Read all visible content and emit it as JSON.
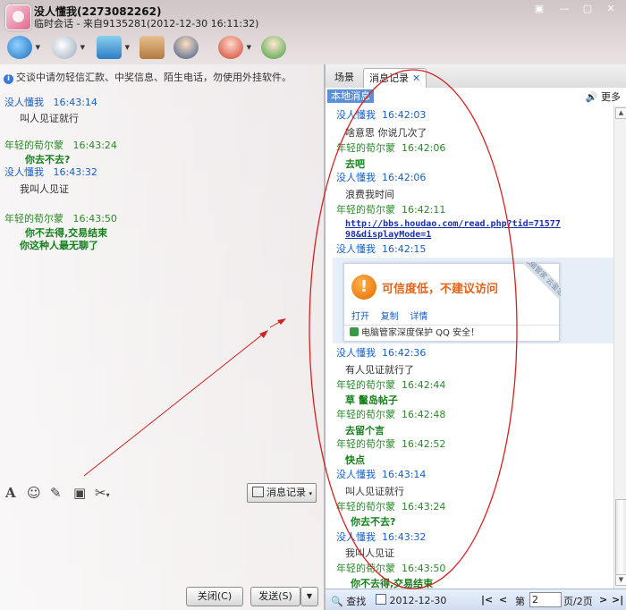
{
  "window": {
    "contact_name": "没人懂我(2273082262)",
    "session_info": "临时会话 - 来自9135281(2012-12-30 16:11:32)",
    "controls": [
      "▣",
      "—",
      "▢",
      "✕"
    ]
  },
  "left": {
    "notice": "交谈中请勿轻信汇款、中奖信息、陌生电话，勿使用外挂软件。",
    "messages": [
      {
        "sender": "没人懂我",
        "time": "16:43:14",
        "text": "叫人见证就行",
        "sender_color": "blue"
      },
      {
        "sender": "年轻的荀尔蒙",
        "time": "16:43:24",
        "text": "你去不去?",
        "sender_color": "green"
      },
      {
        "sender": "没人懂我",
        "time": "16:43:32",
        "text": "我叫人见证",
        "sender_color": "blue"
      },
      {
        "sender": "年轻的荀尔蒙",
        "time": "16:43:50",
        "text": "你不去得,交易结束",
        "text2": "你这种人最无聊了",
        "sender_color": "green"
      }
    ],
    "toolbar": {
      "message_record_label": "消息记录"
    },
    "buttons": {
      "close_label": "关闭(C)",
      "send_label": "发送(S)"
    }
  },
  "right": {
    "tabs": [
      {
        "label": "场景"
      },
      {
        "label": "消息记录"
      }
    ],
    "local_tag": "本地消息",
    "more_label": "更多",
    "history": [
      {
        "sender": "没人懂我",
        "time": "16:42:03",
        "text": "啥意思  你说几次了",
        "kind": "normal",
        "sender_color": "blue"
      },
      {
        "sender": "年轻的荀尔蒙",
        "time": "16:42:06",
        "text": "去吧",
        "kind": "bold",
        "sender_color": "green"
      },
      {
        "sender": "没人懂我",
        "time": "16:42:06",
        "text": "浪费我时间",
        "kind": "normal",
        "sender_color": "blue"
      },
      {
        "sender": "年轻的荀尔蒙",
        "time": "16:42:11",
        "text": "http://bbs.houdao.com/read.php?tid=71577",
        "text2": "98&displayMode=1",
        "kind": "link",
        "sender_color": "green"
      },
      {
        "sender": "没人懂我",
        "time": "16:42:15",
        "text": "",
        "kind": "warning",
        "sender_color": "blue"
      },
      {
        "sender": "没人懂我",
        "time": "16:42:36",
        "text": "有人见证就行了",
        "kind": "normal",
        "sender_color": "blue"
      },
      {
        "sender": "年轻的荀尔蒙",
        "time": "16:42:44",
        "text": "草      鬣岛帖子",
        "kind": "bold",
        "sender_color": "green"
      },
      {
        "sender": "年轻的荀尔蒙",
        "time": "16:42:48",
        "text": "去留个言",
        "kind": "bold",
        "sender_color": "green"
      },
      {
        "sender": "年轻的荀尔蒙",
        "time": "16:42:52",
        "text": "快点",
        "kind": "bold",
        "sender_color": "green"
      },
      {
        "sender": "没人懂我",
        "time": "16:43:14",
        "text": "叫人见证就行",
        "kind": "normal",
        "sender_color": "blue"
      },
      {
        "sender": "年轻的荀尔蒙",
        "time": "16:43:24",
        "text": "你去不去?",
        "kind": "bold",
        "sender_color": "green"
      },
      {
        "sender": "没人懂我",
        "time": "16:43:32",
        "text": "我叫人见证",
        "kind": "normal",
        "sender_color": "blue"
      },
      {
        "sender": "年轻的荀尔蒙",
        "time": "16:43:50",
        "text": "你不去得,交易结束",
        "kind": "bold",
        "sender_color": "green"
      }
    ],
    "warning": {
      "title": "可信度低，不建议访问",
      "links": [
        "打开",
        "复制",
        "详情"
      ],
      "footer": "电脑管家深度保护 QQ 安全！",
      "ribbon": "电脑管家 云鉴定"
    },
    "bottom": {
      "search_label": "查找",
      "date": "2012-12-30",
      "page_prefix": "第",
      "page_value": "2",
      "page_suffix": "页/2页"
    }
  },
  "colors": {
    "sender_blue": "#1560c8",
    "sender_green": "#2a8a2a",
    "accent": "#5b8fd6",
    "warning": "#e0641a"
  }
}
